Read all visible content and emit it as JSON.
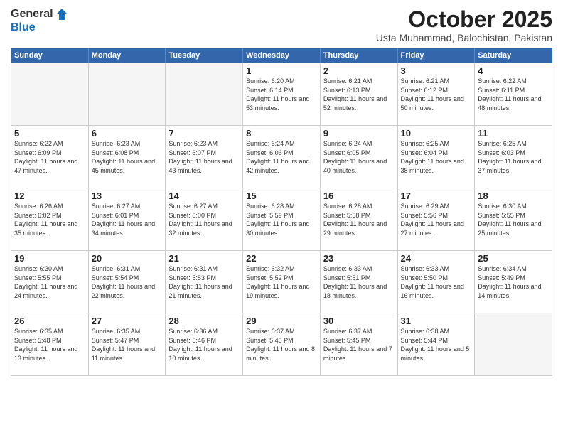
{
  "header": {
    "logo_general": "General",
    "logo_blue": "Blue",
    "month": "October 2025",
    "location": "Usta Muhammad, Balochistan, Pakistan"
  },
  "days_of_week": [
    "Sunday",
    "Monday",
    "Tuesday",
    "Wednesday",
    "Thursday",
    "Friday",
    "Saturday"
  ],
  "weeks": [
    [
      {
        "day": "",
        "sunrise": "",
        "sunset": "",
        "daylight": "",
        "empty": true
      },
      {
        "day": "",
        "sunrise": "",
        "sunset": "",
        "daylight": "",
        "empty": true
      },
      {
        "day": "",
        "sunrise": "",
        "sunset": "",
        "daylight": "",
        "empty": true
      },
      {
        "day": "1",
        "sunrise": "Sunrise: 6:20 AM",
        "sunset": "Sunset: 6:14 PM",
        "daylight": "Daylight: 11 hours and 53 minutes.",
        "empty": false
      },
      {
        "day": "2",
        "sunrise": "Sunrise: 6:21 AM",
        "sunset": "Sunset: 6:13 PM",
        "daylight": "Daylight: 11 hours and 52 minutes.",
        "empty": false
      },
      {
        "day": "3",
        "sunrise": "Sunrise: 6:21 AM",
        "sunset": "Sunset: 6:12 PM",
        "daylight": "Daylight: 11 hours and 50 minutes.",
        "empty": false
      },
      {
        "day": "4",
        "sunrise": "Sunrise: 6:22 AM",
        "sunset": "Sunset: 6:11 PM",
        "daylight": "Daylight: 11 hours and 48 minutes.",
        "empty": false
      }
    ],
    [
      {
        "day": "5",
        "sunrise": "Sunrise: 6:22 AM",
        "sunset": "Sunset: 6:09 PM",
        "daylight": "Daylight: 11 hours and 47 minutes.",
        "empty": false
      },
      {
        "day": "6",
        "sunrise": "Sunrise: 6:23 AM",
        "sunset": "Sunset: 6:08 PM",
        "daylight": "Daylight: 11 hours and 45 minutes.",
        "empty": false
      },
      {
        "day": "7",
        "sunrise": "Sunrise: 6:23 AM",
        "sunset": "Sunset: 6:07 PM",
        "daylight": "Daylight: 11 hours and 43 minutes.",
        "empty": false
      },
      {
        "day": "8",
        "sunrise": "Sunrise: 6:24 AM",
        "sunset": "Sunset: 6:06 PM",
        "daylight": "Daylight: 11 hours and 42 minutes.",
        "empty": false
      },
      {
        "day": "9",
        "sunrise": "Sunrise: 6:24 AM",
        "sunset": "Sunset: 6:05 PM",
        "daylight": "Daylight: 11 hours and 40 minutes.",
        "empty": false
      },
      {
        "day": "10",
        "sunrise": "Sunrise: 6:25 AM",
        "sunset": "Sunset: 6:04 PM",
        "daylight": "Daylight: 11 hours and 38 minutes.",
        "empty": false
      },
      {
        "day": "11",
        "sunrise": "Sunrise: 6:25 AM",
        "sunset": "Sunset: 6:03 PM",
        "daylight": "Daylight: 11 hours and 37 minutes.",
        "empty": false
      }
    ],
    [
      {
        "day": "12",
        "sunrise": "Sunrise: 6:26 AM",
        "sunset": "Sunset: 6:02 PM",
        "daylight": "Daylight: 11 hours and 35 minutes.",
        "empty": false
      },
      {
        "day": "13",
        "sunrise": "Sunrise: 6:27 AM",
        "sunset": "Sunset: 6:01 PM",
        "daylight": "Daylight: 11 hours and 34 minutes.",
        "empty": false
      },
      {
        "day": "14",
        "sunrise": "Sunrise: 6:27 AM",
        "sunset": "Sunset: 6:00 PM",
        "daylight": "Daylight: 11 hours and 32 minutes.",
        "empty": false
      },
      {
        "day": "15",
        "sunrise": "Sunrise: 6:28 AM",
        "sunset": "Sunset: 5:59 PM",
        "daylight": "Daylight: 11 hours and 30 minutes.",
        "empty": false
      },
      {
        "day": "16",
        "sunrise": "Sunrise: 6:28 AM",
        "sunset": "Sunset: 5:58 PM",
        "daylight": "Daylight: 11 hours and 29 minutes.",
        "empty": false
      },
      {
        "day": "17",
        "sunrise": "Sunrise: 6:29 AM",
        "sunset": "Sunset: 5:56 PM",
        "daylight": "Daylight: 11 hours and 27 minutes.",
        "empty": false
      },
      {
        "day": "18",
        "sunrise": "Sunrise: 6:30 AM",
        "sunset": "Sunset: 5:55 PM",
        "daylight": "Daylight: 11 hours and 25 minutes.",
        "empty": false
      }
    ],
    [
      {
        "day": "19",
        "sunrise": "Sunrise: 6:30 AM",
        "sunset": "Sunset: 5:55 PM",
        "daylight": "Daylight: 11 hours and 24 minutes.",
        "empty": false
      },
      {
        "day": "20",
        "sunrise": "Sunrise: 6:31 AM",
        "sunset": "Sunset: 5:54 PM",
        "daylight": "Daylight: 11 hours and 22 minutes.",
        "empty": false
      },
      {
        "day": "21",
        "sunrise": "Sunrise: 6:31 AM",
        "sunset": "Sunset: 5:53 PM",
        "daylight": "Daylight: 11 hours and 21 minutes.",
        "empty": false
      },
      {
        "day": "22",
        "sunrise": "Sunrise: 6:32 AM",
        "sunset": "Sunset: 5:52 PM",
        "daylight": "Daylight: 11 hours and 19 minutes.",
        "empty": false
      },
      {
        "day": "23",
        "sunrise": "Sunrise: 6:33 AM",
        "sunset": "Sunset: 5:51 PM",
        "daylight": "Daylight: 11 hours and 18 minutes.",
        "empty": false
      },
      {
        "day": "24",
        "sunrise": "Sunrise: 6:33 AM",
        "sunset": "Sunset: 5:50 PM",
        "daylight": "Daylight: 11 hours and 16 minutes.",
        "empty": false
      },
      {
        "day": "25",
        "sunrise": "Sunrise: 6:34 AM",
        "sunset": "Sunset: 5:49 PM",
        "daylight": "Daylight: 11 hours and 14 minutes.",
        "empty": false
      }
    ],
    [
      {
        "day": "26",
        "sunrise": "Sunrise: 6:35 AM",
        "sunset": "Sunset: 5:48 PM",
        "daylight": "Daylight: 11 hours and 13 minutes.",
        "empty": false
      },
      {
        "day": "27",
        "sunrise": "Sunrise: 6:35 AM",
        "sunset": "Sunset: 5:47 PM",
        "daylight": "Daylight: 11 hours and 11 minutes.",
        "empty": false
      },
      {
        "day": "28",
        "sunrise": "Sunrise: 6:36 AM",
        "sunset": "Sunset: 5:46 PM",
        "daylight": "Daylight: 11 hours and 10 minutes.",
        "empty": false
      },
      {
        "day": "29",
        "sunrise": "Sunrise: 6:37 AM",
        "sunset": "Sunset: 5:45 PM",
        "daylight": "Daylight: 11 hours and 8 minutes.",
        "empty": false
      },
      {
        "day": "30",
        "sunrise": "Sunrise: 6:37 AM",
        "sunset": "Sunset: 5:45 PM",
        "daylight": "Daylight: 11 hours and 7 minutes.",
        "empty": false
      },
      {
        "day": "31",
        "sunrise": "Sunrise: 6:38 AM",
        "sunset": "Sunset: 5:44 PM",
        "daylight": "Daylight: 11 hours and 5 minutes.",
        "empty": false
      },
      {
        "day": "",
        "sunrise": "",
        "sunset": "",
        "daylight": "",
        "empty": true
      }
    ]
  ]
}
